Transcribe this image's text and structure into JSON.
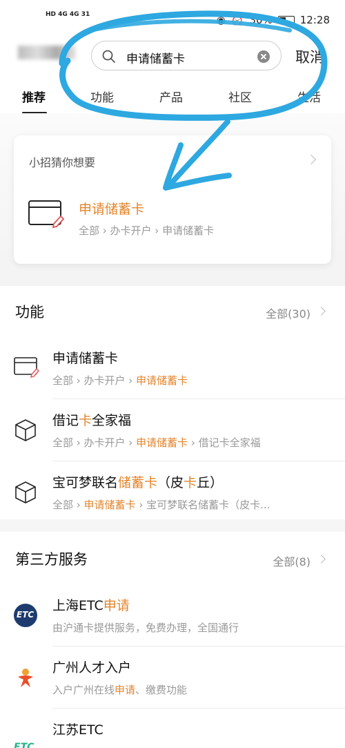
{
  "status": {
    "left": "HD 4G 4G 31",
    "time": "12:28",
    "battery": "30%"
  },
  "search": {
    "query": "申请储蓄卡",
    "cancel": "取消"
  },
  "tabs": [
    "推荐",
    "功能",
    "产品",
    "社区",
    "生活"
  ],
  "suggest": {
    "title": "小招猜你想要",
    "name": "申请储蓄卡",
    "path": "全部 › 办卡开户 › 申请储蓄卡"
  },
  "functions": {
    "title": "功能",
    "all": "全部(30)",
    "items": [
      {
        "name": "申请储蓄卡",
        "path_a": "全部 › 办卡开户 › ",
        "path_b": "申请储蓄卡",
        "path_c": ""
      },
      {
        "name_a": "借记",
        "name_b": "卡",
        "name_c": "全家福",
        "path_a": "全部 › 办卡开户 › ",
        "path_b": "申请储蓄卡",
        "path_c": " › 借记卡全家福"
      },
      {
        "name_a": "宝可梦联名",
        "name_b": "储蓄卡",
        "name_c": "（皮",
        "name_d": "卡",
        "name_e": "丘）",
        "path_a": "全部 › ",
        "path_b": "申请储蓄卡",
        "path_c": " › 宝可梦联名储蓄卡（皮卡..."
      }
    ]
  },
  "third": {
    "title": "第三方服务",
    "all": "全部(8)",
    "items": [
      {
        "name_a": "上海ETC",
        "name_b": "申请",
        "desc": "由沪通卡提供服务，免费办理，全国通行",
        "logo": "ETC"
      },
      {
        "name": "广州人才入户",
        "desc_a": "入户广州在线",
        "desc_b": "申请",
        "desc_c": "、缴费功能",
        "logo": "person-logo"
      },
      {
        "name": "江苏ETC",
        "logo": "ETC"
      }
    ]
  },
  "colors": {
    "accent": "#e3852c",
    "annotation": "#2ea8e0"
  }
}
